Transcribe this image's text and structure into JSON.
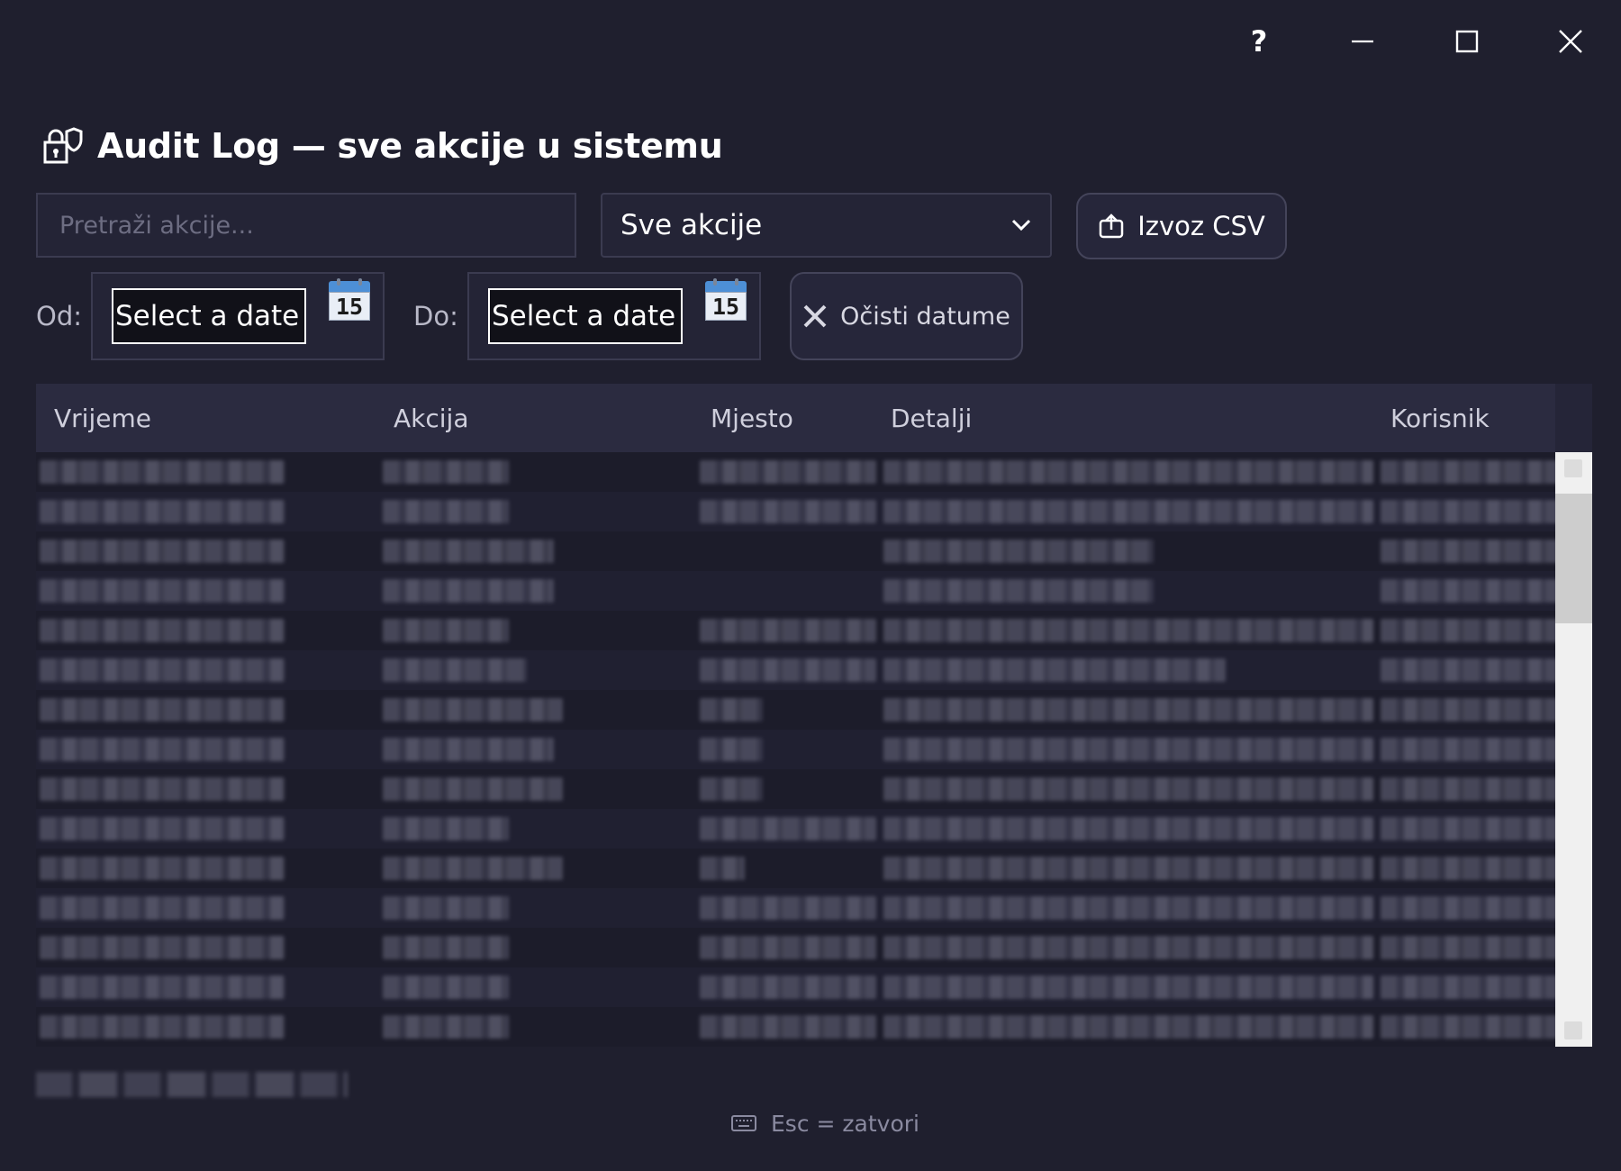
{
  "window_controls": {
    "help": "?"
  },
  "header": {
    "title": "Audit Log — sve akcije u sistemu",
    "icon": "lock-shield-icon"
  },
  "toolbar": {
    "search_placeholder": "Pretraži akcije...",
    "action_filter_value": "Sve akcije",
    "export_label": "Izvoz CSV",
    "export_icon": "export-icon"
  },
  "dates": {
    "from_label": "Od:",
    "to_label": "Do:",
    "from_value": "Select a date",
    "to_value": "Select a date",
    "calendar_day": "15",
    "clear_label": "Očisti datume"
  },
  "table": {
    "columns": [
      "Vrijeme",
      "Akcija",
      "Mjesto",
      "Detalji",
      "Korisnik"
    ],
    "rows_note_redacted": true
  },
  "footer": {
    "hint": "Esc = zatvori",
    "hint_icon": "keyboard-icon"
  },
  "colors": {
    "background": "#1f1f2e",
    "header": "#2b2b40",
    "accent": "#4d8fd6"
  }
}
